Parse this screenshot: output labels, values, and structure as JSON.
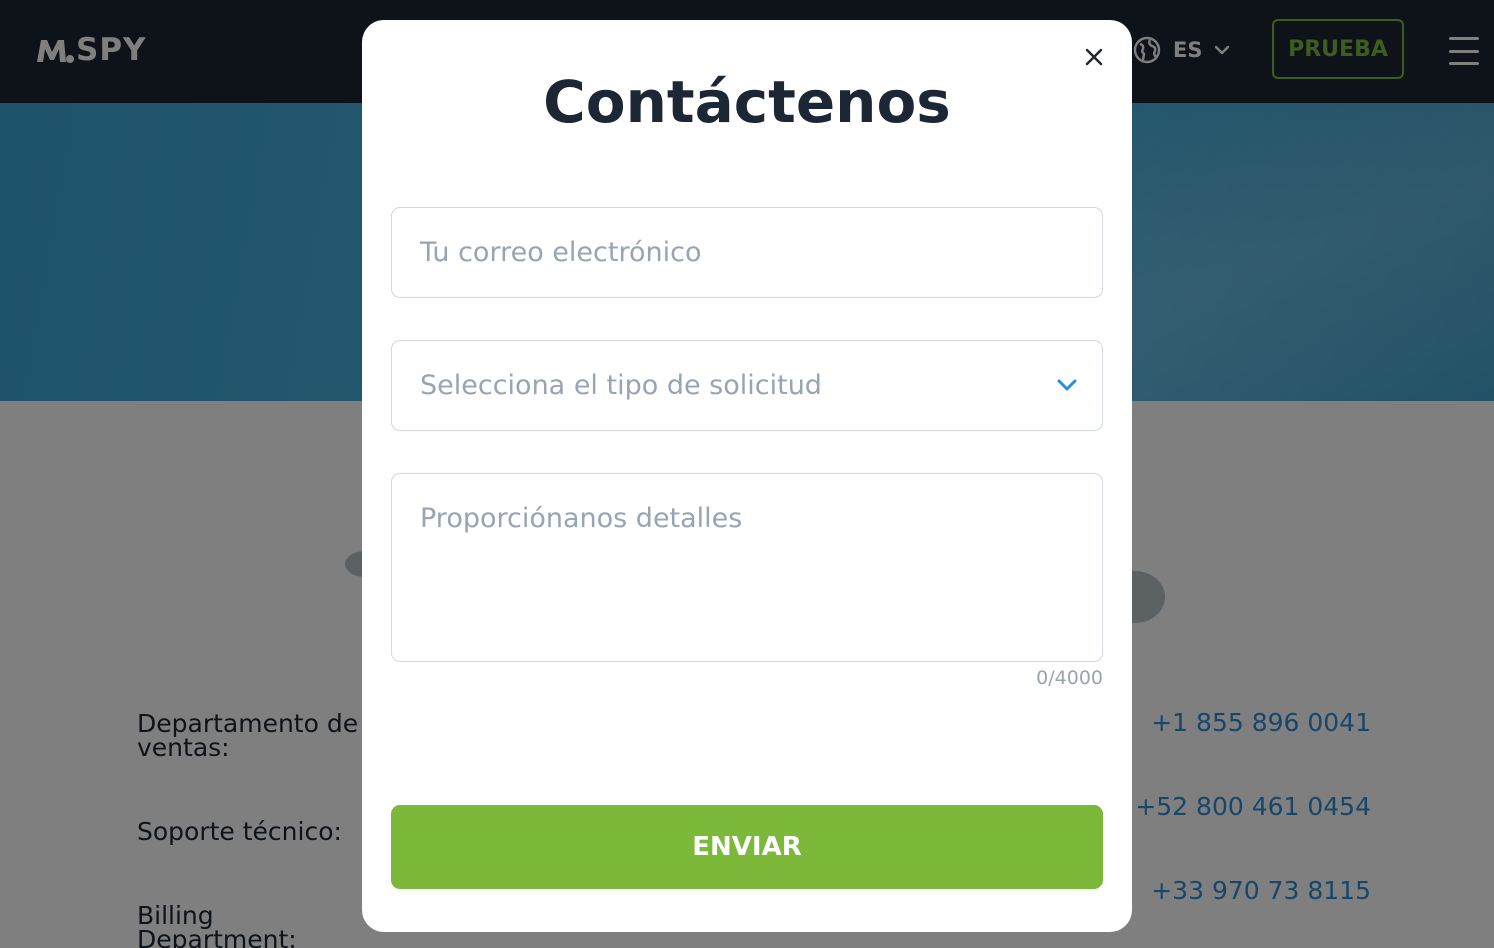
{
  "header": {
    "logo_text": "SPY",
    "language": "ES",
    "trial_label": "PRUEBA"
  },
  "contacts": [
    {
      "label": "Departamento de ventas:",
      "phone": "+1 855 896 0041"
    },
    {
      "label": "Soporte técnico:",
      "phone": "+52 800 461 0454"
    },
    {
      "label": "Billing Department:",
      "phone": "+33 970 73 8115"
    }
  ],
  "modal": {
    "title": "Contáctenos",
    "email_placeholder": "Tu correo electrónico",
    "request_type_placeholder": "Selecciona el tipo de solicitud",
    "details_placeholder": "Proporciónanos detalles",
    "char_count": "0/4000",
    "submit_label": "ENVIAR"
  },
  "colors": {
    "header_bg": "#1d2634",
    "hero_blue": "#52b9e6",
    "accent_green": "#7cb83a",
    "link_blue": "#2c8ed6",
    "placeholder": "#98a4b3"
  },
  "icons": {
    "logo": "mspy-logo-icon",
    "globe": "globe-icon",
    "language_chevron": "chevron-down-icon",
    "menu": "hamburger-menu-icon",
    "close": "close-icon",
    "select_chevron": "chevron-down-icon"
  }
}
